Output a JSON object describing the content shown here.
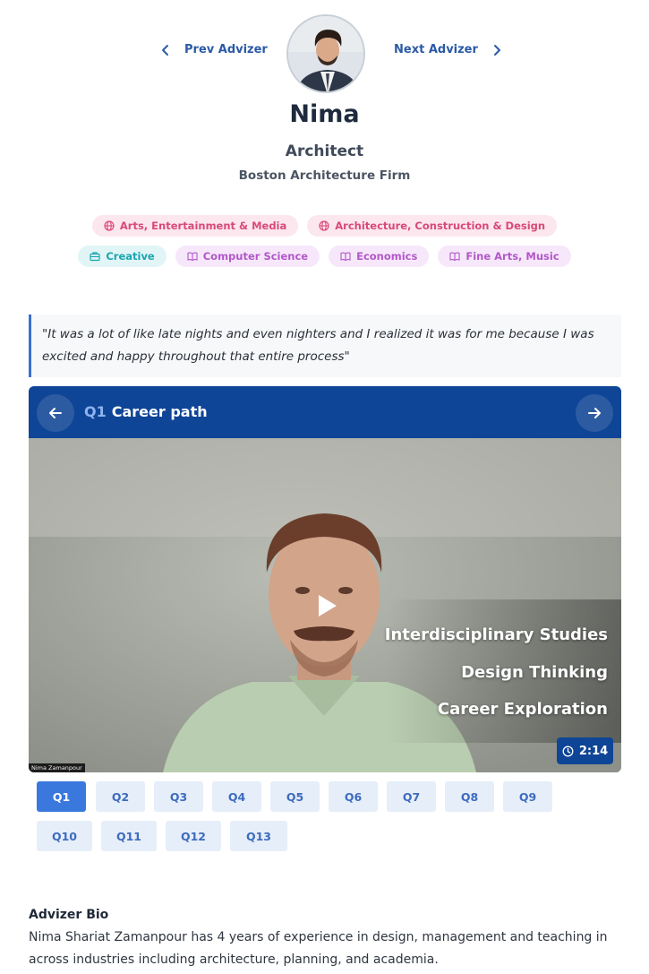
{
  "nav": {
    "prev_label": "Prev Advizer",
    "next_label": "Next Advizer"
  },
  "profile": {
    "name": "Nima",
    "role": "Architect",
    "company": "Boston Architecture Firm"
  },
  "tags": [
    {
      "label": "Arts, Entertainment & Media",
      "icon": "globe-icon",
      "color": "#d84a78"
    },
    {
      "label": "Architecture, Construction & Design",
      "icon": "globe-icon",
      "color": "#d84a78"
    },
    {
      "label": "Creative",
      "icon": "briefcase-icon",
      "color": "#1aa5b0"
    },
    {
      "label": "Computer Science",
      "icon": "book-icon",
      "color": "#b357c9"
    },
    {
      "label": "Economics",
      "icon": "book-icon",
      "color": "#b357c9"
    },
    {
      "label": "Fine Arts, Music",
      "icon": "book-icon",
      "color": "#b357c9"
    }
  ],
  "quote": "\"It was a lot of like late nights and even nighters and I realized it was for me because I was excited and happy throughout that entire process\"",
  "question": {
    "number": "Q1",
    "title": "Career path"
  },
  "video": {
    "overlay_lines": [
      "Interdisciplinary Studies",
      "Design Thinking",
      "Career Exploration"
    ],
    "duration": "2:14",
    "speaker_label": "Nima Zamanpour"
  },
  "question_buttons": [
    "Q1",
    "Q2",
    "Q3",
    "Q4",
    "Q5",
    "Q6",
    "Q7",
    "Q8",
    "Q9",
    "Q10",
    "Q11",
    "Q12",
    "Q13"
  ],
  "active_question": "Q1",
  "bio": {
    "title": "Advizer Bio",
    "text": "Nima Shariat Zamanpour has 4 years of experience in design, management and teaching in across industries including architecture, planning, and academia."
  },
  "colors": {
    "accent_blue": "#0f4596",
    "active_button": "#3a78de",
    "link_blue": "#2b5aa6"
  }
}
